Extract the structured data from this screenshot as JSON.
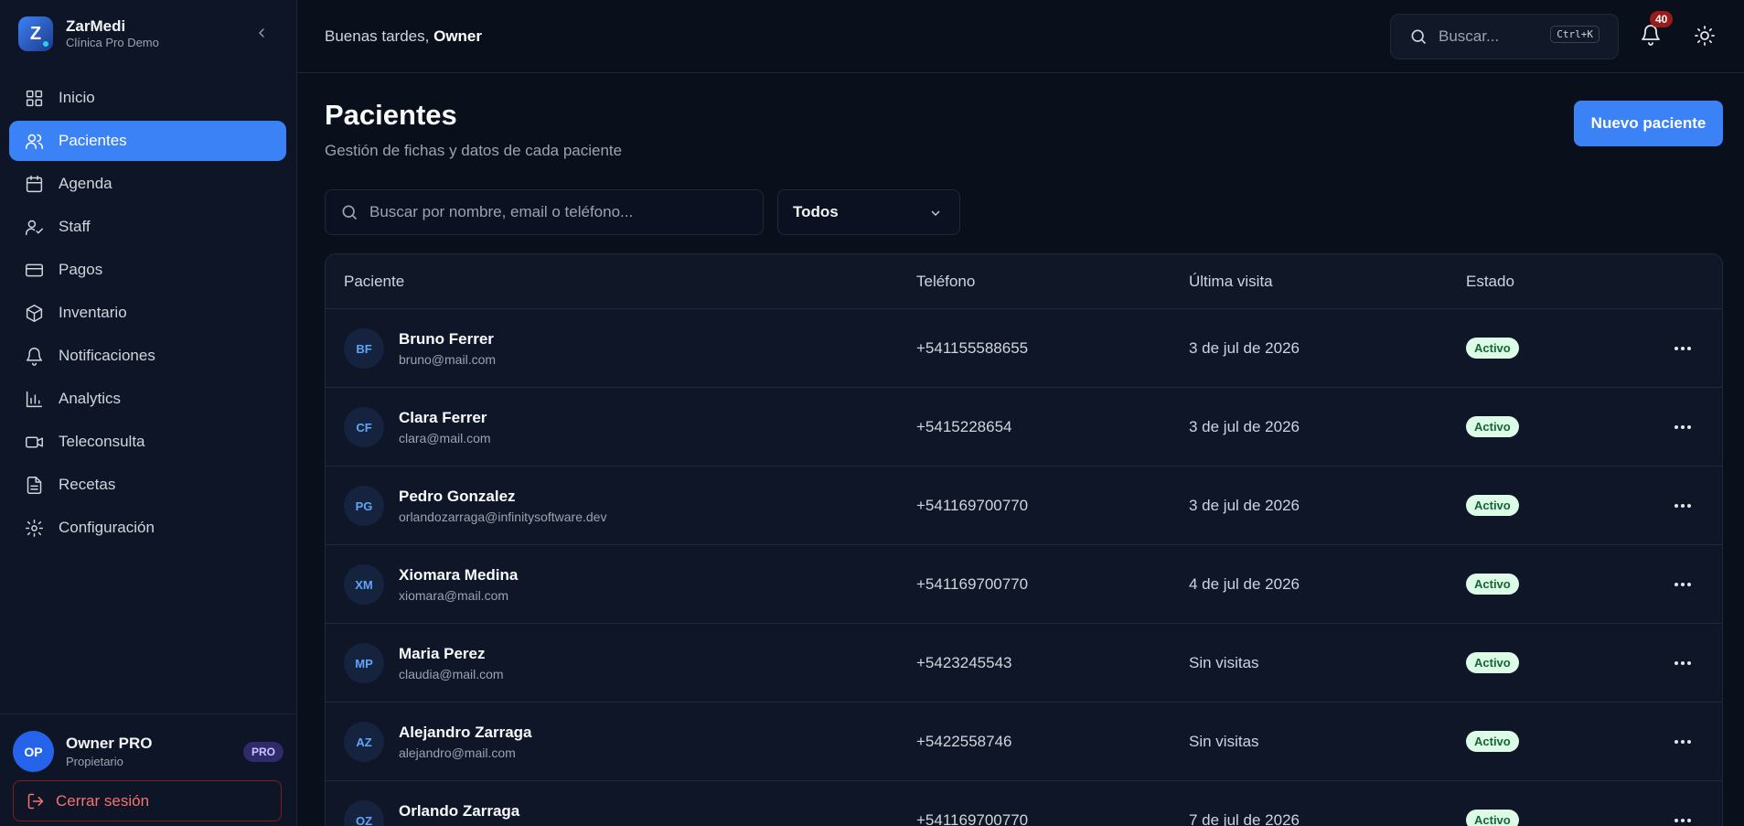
{
  "brand": {
    "name": "ZarMedi",
    "subtitle": "Clínica Pro Demo",
    "logo_letter": "Z"
  },
  "nav": [
    {
      "label": "Inicio",
      "icon": "grid-icon",
      "active": false
    },
    {
      "label": "Pacientes",
      "icon": "users-icon",
      "active": true
    },
    {
      "label": "Agenda",
      "icon": "calendar-icon",
      "active": false
    },
    {
      "label": "Staff",
      "icon": "user-check-icon",
      "active": false
    },
    {
      "label": "Pagos",
      "icon": "credit-card-icon",
      "active": false
    },
    {
      "label": "Inventario",
      "icon": "box-icon",
      "active": false
    },
    {
      "label": "Notificaciones",
      "icon": "bell-icon",
      "active": false
    },
    {
      "label": "Analytics",
      "icon": "bar-chart-icon",
      "active": false
    },
    {
      "label": "Teleconsulta",
      "icon": "video-icon",
      "active": false
    },
    {
      "label": "Recetas",
      "icon": "file-text-icon",
      "active": false
    },
    {
      "label": "Configuración",
      "icon": "settings-icon",
      "active": false
    }
  ],
  "user": {
    "initials": "OP",
    "name": "Owner PRO",
    "role": "Propietario",
    "badge": "PRO",
    "logout": "Cerrar sesión"
  },
  "topbar": {
    "greeting": "Buenas tardes,",
    "greeting_name": "Owner",
    "search_placeholder": "Buscar...",
    "search_shortcut": "Ctrl+K",
    "notification_count": "40"
  },
  "page": {
    "title": "Pacientes",
    "subtitle": "Gestión de fichas y datos de cada paciente",
    "new_button": "Nuevo paciente",
    "search_placeholder": "Buscar por nombre, email o teléfono...",
    "filter_value": "Todos"
  },
  "table": {
    "columns": [
      "Paciente",
      "Teléfono",
      "Última visita",
      "Estado"
    ],
    "rows": [
      {
        "initials": "BF",
        "name": "Bruno Ferrer",
        "email": "bruno@mail.com",
        "phone": "+541155588655",
        "last_visit": "3 de jul de 2026",
        "status": "Activo"
      },
      {
        "initials": "CF",
        "name": "Clara Ferrer",
        "email": "clara@mail.com",
        "phone": "+5415228654",
        "last_visit": "3 de jul de 2026",
        "status": "Activo"
      },
      {
        "initials": "PG",
        "name": "Pedro Gonzalez",
        "email": "orlandozarraga@infinitysoftware.dev",
        "phone": "+541169700770",
        "last_visit": "3 de jul de 2026",
        "status": "Activo"
      },
      {
        "initials": "XM",
        "name": "Xiomara Medina",
        "email": "xiomara@mail.com",
        "phone": "+541169700770",
        "last_visit": "4 de jul de 2026",
        "status": "Activo"
      },
      {
        "initials": "MP",
        "name": "Maria Perez",
        "email": "claudia@mail.com",
        "phone": "+5423245543",
        "last_visit": "Sin visitas",
        "status": "Activo"
      },
      {
        "initials": "AZ",
        "name": "Alejandro Zarraga",
        "email": "alejandro@mail.com",
        "phone": "+5422558746",
        "last_visit": "Sin visitas",
        "status": "Activo"
      },
      {
        "initials": "OZ",
        "name": "Orlando Zarraga",
        "email": "",
        "phone": "+541169700770",
        "last_visit": "7 de jul de 2026",
        "status": "Activo"
      }
    ]
  },
  "colors": {
    "accent": "#3b82f6",
    "background": "#0a0f1c",
    "status_active_bg": "#dcfce7",
    "status_active_text": "#166534",
    "danger": "#f87171"
  }
}
